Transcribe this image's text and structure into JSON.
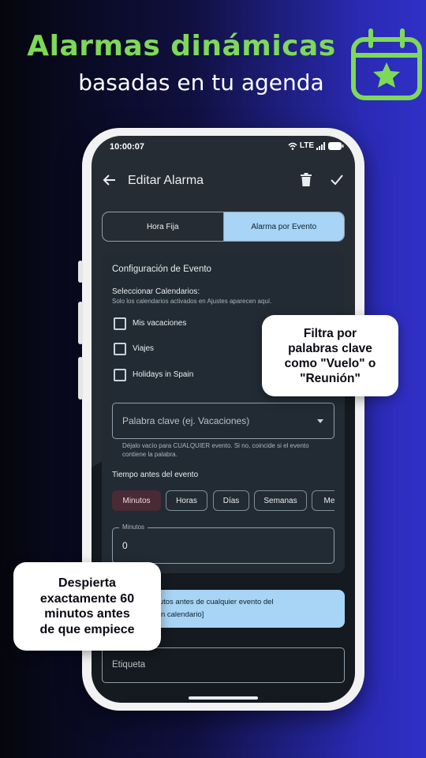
{
  "promo": {
    "headline": "Alarmas dinámicas",
    "subhead": "basadas en tu agenda",
    "accent_color": "#7ed957",
    "icon": "calendar-star-icon",
    "callout_right": [
      "Filtra por",
      "palabras clave",
      "como \"Vuelo\" o",
      "\"Reunión\""
    ],
    "callout_left": [
      "Despierta",
      "exactamente 60",
      "minutos antes",
      "de que empiece"
    ]
  },
  "status_bar": {
    "time": "10:00:07",
    "network": "LTE",
    "icons": [
      "wifi-icon",
      "signal-icon",
      "battery-icon"
    ]
  },
  "appbar": {
    "title": "Editar Alarma",
    "icons": [
      "back-arrow-icon",
      "trash-icon",
      "check-icon"
    ]
  },
  "mode_toggle": {
    "options": [
      "Hora Fija",
      "Alarma por Evento"
    ],
    "selected": "Alarma por Evento"
  },
  "event_config": {
    "title": "Configuración de Evento",
    "calendars_title": "Seleccionar Calendarios:",
    "calendars_help": "Solo los calendarios activados en Ajustes aparecen aquí.",
    "calendars": [
      {
        "label": "Mis vacaciones",
        "checked": false
      },
      {
        "label": "Viajes",
        "checked": false
      },
      {
        "label": "Holidays in Spain",
        "checked": false
      }
    ],
    "keyword_placeholder": "Palabra clave (ej. Vacaciones)",
    "keyword_hint": "Déjalo vacío para CUALQUIER evento. Si no, coincide si el evento contiene la palabra.",
    "time_before_title": "Tiempo antes del evento",
    "units": [
      "Minutos",
      "Horas",
      "Días",
      "Semanas",
      "Mes"
    ],
    "selected_unit": "Minutos",
    "amount_label": "Minutos",
    "amount_value": "0"
  },
  "info_banner": {
    "line1": "a sonará 0 Minutos antes de cualquier evento del",
    "line2": "o [Seleccione un calendario]"
  },
  "label_field": {
    "placeholder": "Etiqueta"
  }
}
